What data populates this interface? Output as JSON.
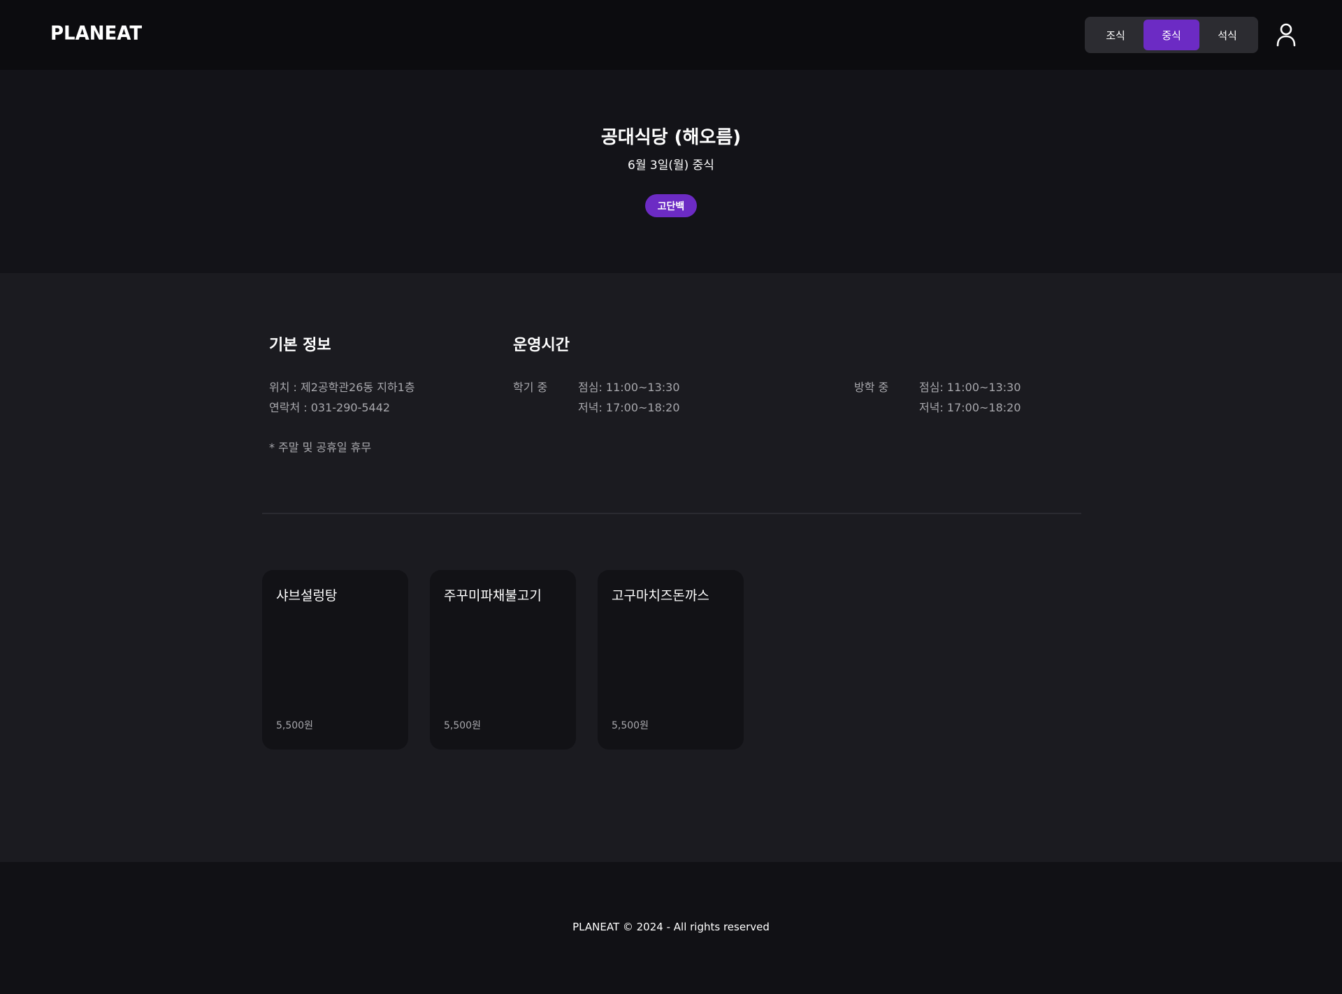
{
  "header": {
    "logo": "PLANEAT",
    "meal_tabs": [
      "조식",
      "중식",
      "석식"
    ],
    "active_tab": "중식",
    "user_icon": "user-icon"
  },
  "hero": {
    "title": "공대식당 (해오름)",
    "date": "6월 3일(월) 중식",
    "badge": "고단백"
  },
  "basic_info": {
    "title": "기본 정보",
    "location": "위치 : 제2공학관26동 지하1층",
    "contact": "연락처 : 031-290-5442",
    "note": "* 주말 및 공휴일 휴무"
  },
  "hours": {
    "title": "운영시간",
    "semester": {
      "label": "학기 중",
      "lunch": "점심: 11:00~13:30",
      "dinner": "저녁: 17:00~18:20"
    },
    "vacation": {
      "label": "방학 중",
      "lunch": "점심: 11:00~13:30",
      "dinner": "저녁: 17:00~18:20"
    }
  },
  "menu": [
    {
      "name": "샤브설렁탕",
      "price": "5,500원"
    },
    {
      "name": "주꾸미파채불고기",
      "price": "5,500원"
    },
    {
      "name": "고구마치즈돈까스",
      "price": "5,500원"
    }
  ],
  "footer": {
    "text": "PLANEAT © 2024 - All rights reserved"
  },
  "colors": {
    "accent": "#6c2bc4",
    "header_bg": "#0c0c0f",
    "hero_bg": "#131318",
    "body_bg": "#1b1b20"
  }
}
